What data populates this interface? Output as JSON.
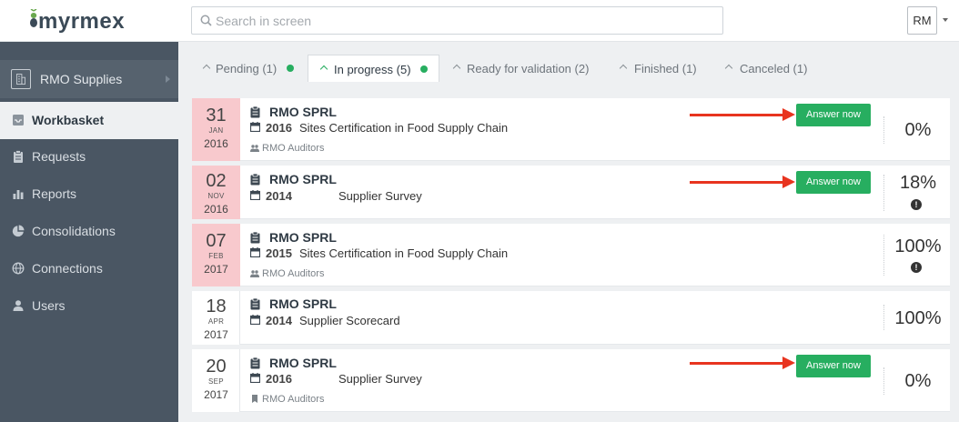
{
  "app": {
    "logo_text": "myrmex",
    "search_placeholder": "Search in screen",
    "user_initials": "RM"
  },
  "sidebar": {
    "org": "RMO Supplies",
    "items": [
      {
        "label": "Workbasket",
        "icon": "inbox-icon",
        "active": true
      },
      {
        "label": "Requests",
        "icon": "clipboard-icon"
      },
      {
        "label": "Reports",
        "icon": "bar-chart-icon"
      },
      {
        "label": "Consolidations",
        "icon": "pie-chart-icon"
      },
      {
        "label": "Connections",
        "icon": "globe-icon"
      },
      {
        "label": "Users",
        "icon": "user-icon"
      }
    ]
  },
  "tabs": [
    {
      "label": "Pending (1)",
      "dot": true
    },
    {
      "label": "In progress (5)",
      "dot": true,
      "active": true
    },
    {
      "label": "Ready for validation (2)"
    },
    {
      "label": "Finished (1)"
    },
    {
      "label": "Canceled (1)"
    }
  ],
  "cards": [
    {
      "day": "31",
      "month": "JAN",
      "year": "2016",
      "company": "RMO SPRL",
      "survey_year": "2016",
      "title": "Sites Certification in Food Supply Chain",
      "auditors": "RMO Auditors",
      "answer_label": "Answer now",
      "percent": "0%"
    },
    {
      "day": "02",
      "month": "NOV",
      "year": "2016",
      "company": "RMO SPRL",
      "survey_year": "2014",
      "title": "Supplier Survey",
      "answer_label": "Answer now",
      "percent": "18%",
      "alert": "!"
    },
    {
      "day": "07",
      "month": "FEB",
      "year": "2017",
      "company": "RMO SPRL",
      "survey_year": "2015",
      "title": "Sites Certification in Food Supply Chain",
      "auditors": "RMO Auditors",
      "percent": "100%",
      "alert": "!"
    },
    {
      "day": "18",
      "month": "APR",
      "year": "2017",
      "company": "RMO SPRL",
      "survey_year": "2014",
      "title": "Supplier Scorecard",
      "percent": "100%"
    },
    {
      "day": "20",
      "month": "SEP",
      "year": "2017",
      "company": "RMO SPRL",
      "survey_year": "2016",
      "title": "Supplier Survey",
      "auditors": "RMO Auditors",
      "answer_label": "Answer now",
      "percent": "0%"
    }
  ],
  "colors": {
    "accent": "#27ae60",
    "sidebar": "#4a5663",
    "overdue": "#f8c9cd",
    "annotation_arrow": "#e8341f"
  }
}
